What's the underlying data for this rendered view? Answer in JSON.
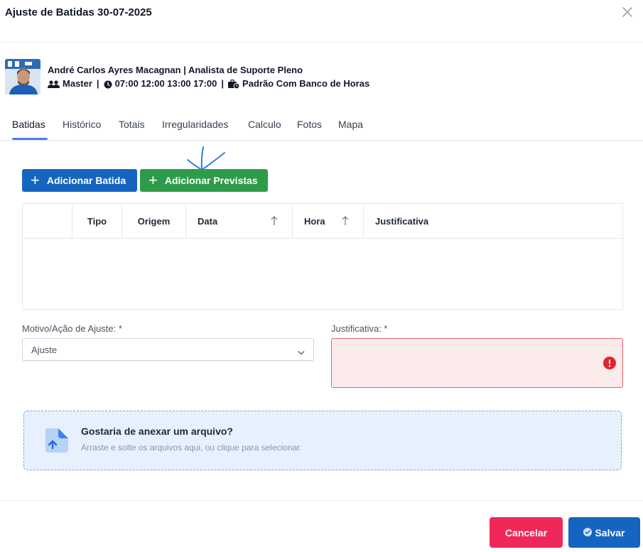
{
  "modal": {
    "title": "Ajuste de Batidas 30-07-2025"
  },
  "employee": {
    "name_role": "André Carlos Ayres Macagnan | Analista de Suporte Pleno",
    "group": "Master",
    "schedule": "07:00 12:00 13:00 17:00",
    "bank": "Padrão Com Banco de Horas",
    "separator": "|"
  },
  "tabs": [
    {
      "label": "Batidas",
      "active": true
    },
    {
      "label": "Histórico"
    },
    {
      "label": "Totais"
    },
    {
      "label": "Irregularidades"
    },
    {
      "label": "Calculo"
    },
    {
      "label": "Fotos"
    },
    {
      "label": "Mapa"
    }
  ],
  "actions": {
    "add_label": "Adicionar Batida",
    "add_prev_label": "Adicionar Previstas"
  },
  "table": {
    "columns": [
      "Tipo",
      "Origem",
      "Data",
      "Hora",
      "Justificativa"
    ],
    "rows": []
  },
  "form": {
    "motivo_label": "Motivo/Ação de Ajuste: *",
    "motivo_value": "Ajuste",
    "justificativa_label": "Justificativa: *",
    "justificativa_value": ""
  },
  "dropzone": {
    "title": "Gostaria de anexar um arquivo?",
    "subtitle": "Arraste e solte os arquivos aqui, ou clique para selecionar."
  },
  "footer": {
    "cancel_label": "Cancelar",
    "save_label": "Salvar"
  },
  "colors": {
    "primary": "#1565c0",
    "success": "#2e9b4a",
    "danger": "#f0285a",
    "tab_active": "#4a7ef0",
    "error": "#e0242c"
  }
}
